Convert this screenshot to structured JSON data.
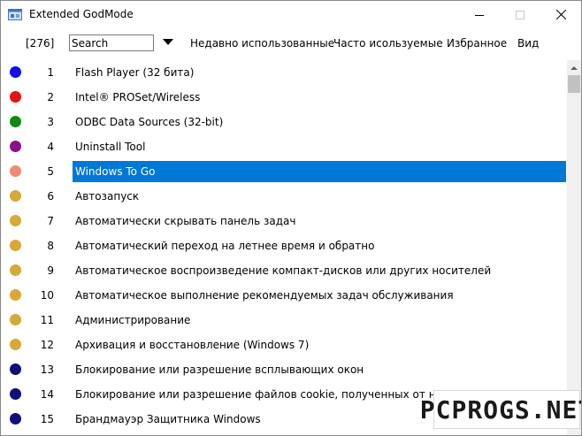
{
  "window": {
    "title": "Extended GodMode"
  },
  "toolbar": {
    "count": "[276]",
    "search_value": "Search",
    "menu": [
      "Недавно использованные",
      "Часто исользуемые",
      "Избранное",
      "Вид"
    ]
  },
  "items": [
    {
      "n": "1",
      "label": "Flash Player (32 бита)",
      "color": "#1010e8"
    },
    {
      "n": "2",
      "label": "Intel® PROSet/Wireless",
      "color": "#e81010"
    },
    {
      "n": "3",
      "label": "ODBC Data Sources (32-bit)",
      "color": "#108a10"
    },
    {
      "n": "4",
      "label": "Uninstall Tool",
      "color": "#8a1090"
    },
    {
      "n": "5",
      "label": "Windows To Go",
      "color": "#f08a70",
      "selected": true
    },
    {
      "n": "6",
      "label": "Автозапуск",
      "color": "#d8a838"
    },
    {
      "n": "7",
      "label": "Автоматически скрывать панель задач",
      "color": "#d8a838"
    },
    {
      "n": "8",
      "label": "Автоматический переход на летнее время и обратно",
      "color": "#d8a838"
    },
    {
      "n": "9",
      "label": "Автоматическое воспроизведение компакт-дисков или других носителей",
      "color": "#d8a838"
    },
    {
      "n": "10",
      "label": "Автоматическое выполнение рекомендуемых задач обслуживания",
      "color": "#d8a838"
    },
    {
      "n": "11",
      "label": "Администрирование",
      "color": "#d8a838"
    },
    {
      "n": "12",
      "label": "Архивация и восстановление (Windows 7)",
      "color": "#d8a838"
    },
    {
      "n": "13",
      "label": "Блокирование или разрешение всплывающих окон",
      "color": "#10107a"
    },
    {
      "n": "14",
      "label": "Блокирование или разрешение файлов cookie, полученных от независимых изготовителей",
      "color": "#10107a"
    },
    {
      "n": "15",
      "label": "Брандмауэр Защитника Windows",
      "color": "#10107a"
    }
  ],
  "watermark": "PCPROGS.NET"
}
